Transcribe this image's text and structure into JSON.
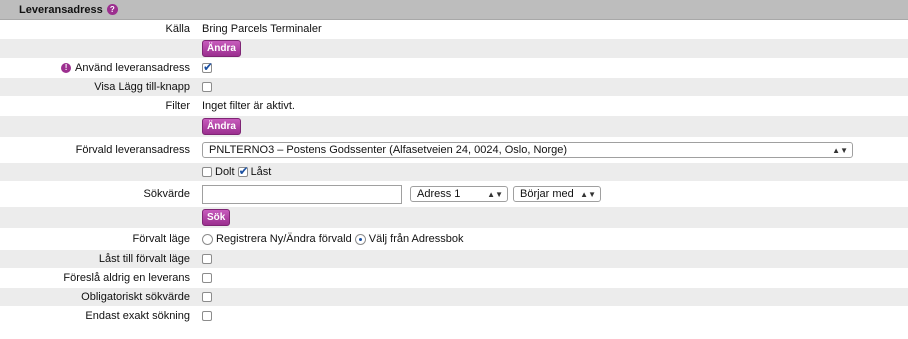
{
  "header": {
    "title": "Leveransadress",
    "help_icon": "help-icon"
  },
  "rows": {
    "kalla": {
      "label": "Källa",
      "value": "Bring Parcels Terminaler"
    },
    "andra1": {
      "button": "Ändra"
    },
    "anvand": {
      "label": "Använd leveransadress",
      "checked": true
    },
    "visa": {
      "label": "Visa Lägg till-knapp",
      "checked": false
    },
    "filter": {
      "label": "Filter",
      "value": "Inget filter är aktivt."
    },
    "andra2": {
      "button": "Ändra"
    },
    "forvald": {
      "label": "Förvald leveransadress",
      "selected": "PNLTERNO3 – Postens Godssenter (Alfasetveien 24, 0024, Oslo, Norge)"
    },
    "dolt_last": {
      "dolt_label": "Dolt",
      "dolt_checked": false,
      "last_label": "Låst",
      "last_checked": true
    },
    "sokvarde": {
      "label": "Sökvärde",
      "input_value": "",
      "field_select": "Adress 1",
      "mode_select": "Börjar med"
    },
    "sok": {
      "button": "Sök"
    },
    "forvalt_lage": {
      "label": "Förvalt läge",
      "option1": "Registrera Ny/Ändra förvald",
      "option2": "Välj från Adressbok",
      "selected": "option2"
    },
    "last_lage": {
      "label": "Låst till förvalt läge",
      "checked": false
    },
    "foresla": {
      "label": "Föreslå aldrig en leverans",
      "checked": false
    },
    "oblig": {
      "label": "Obligatoriskt sökvärde",
      "checked": false
    },
    "exakt": {
      "label": "Endast exakt sökning",
      "checked": false
    }
  }
}
